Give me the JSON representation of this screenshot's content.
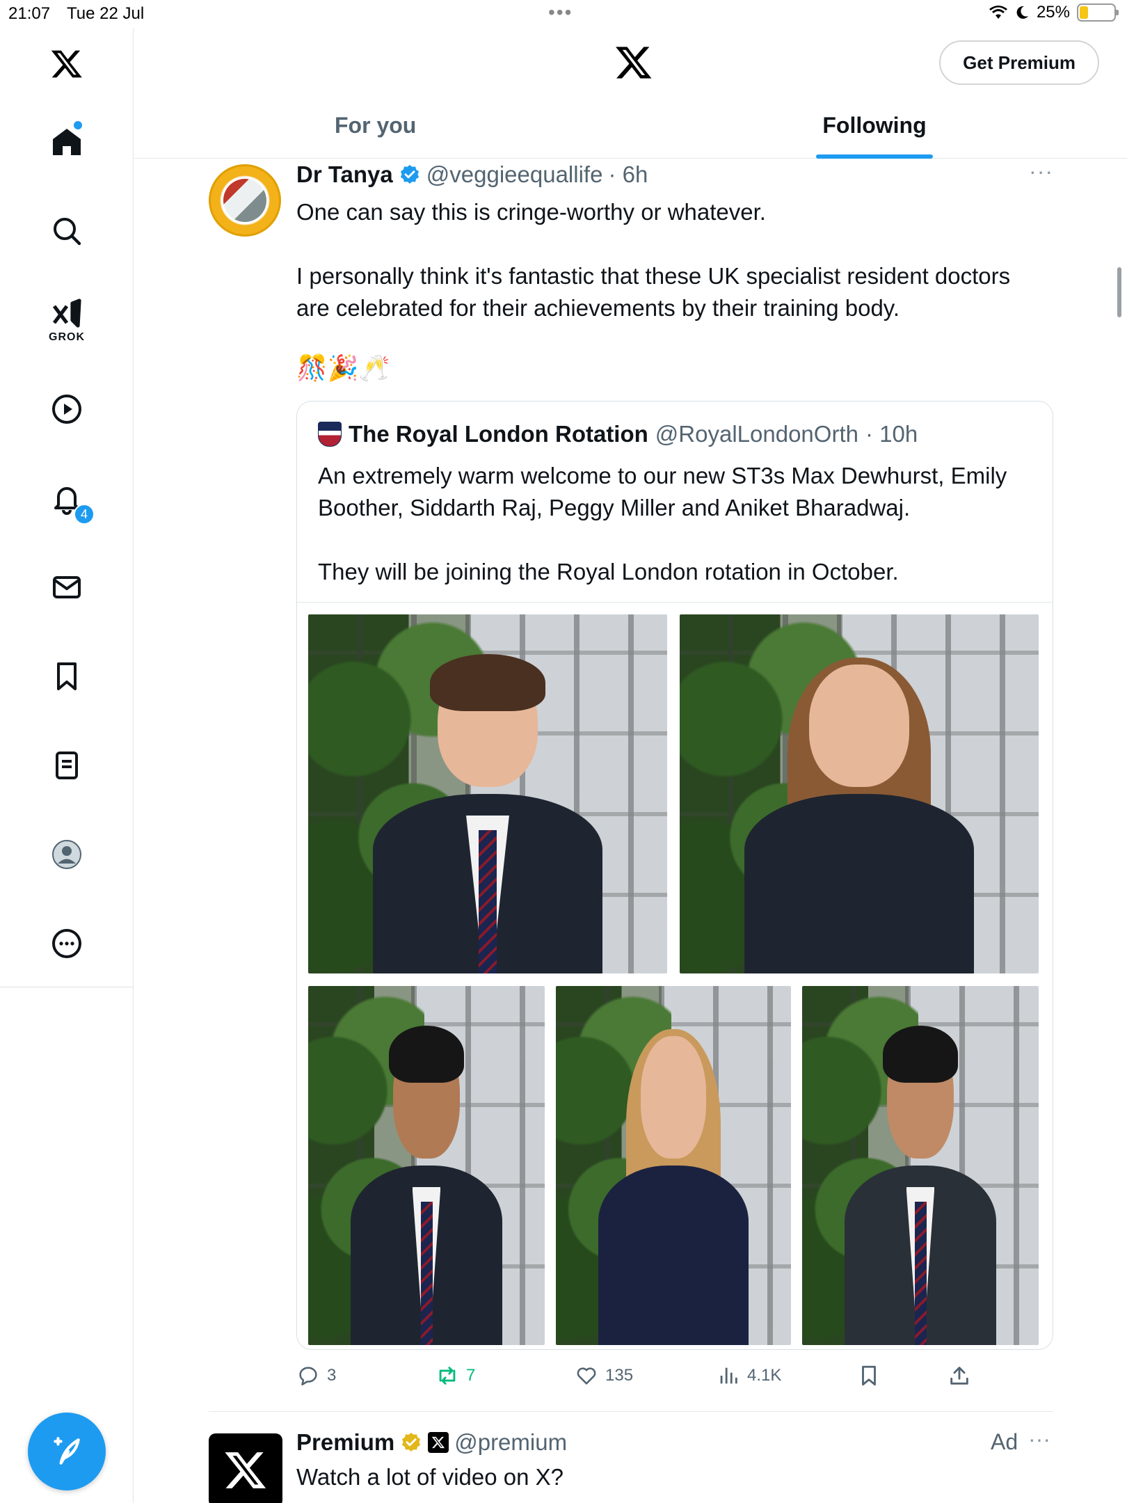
{
  "status_bar": {
    "time": "21:07",
    "date": "Tue 22 Jul",
    "more": "•••",
    "battery": "25%",
    "battery_level": 0.25
  },
  "sidebar": {
    "items": [
      {
        "name": "home",
        "icon": "home-icon"
      },
      {
        "name": "explore",
        "icon": "search-icon"
      },
      {
        "name": "grok",
        "icon": "grok-icon",
        "label": "GROK"
      },
      {
        "name": "videos",
        "icon": "play-icon"
      },
      {
        "name": "notifications",
        "icon": "bell-icon",
        "badge": "4"
      },
      {
        "name": "messages",
        "icon": "mail-icon"
      },
      {
        "name": "bookmarks",
        "icon": "bookmark-icon"
      },
      {
        "name": "lists",
        "icon": "list-icon"
      },
      {
        "name": "profile",
        "icon": "avatar-icon"
      },
      {
        "name": "more",
        "icon": "more-circle-icon"
      }
    ],
    "compose_icon": "compose-icon"
  },
  "header": {
    "premium_button": "Get Premium",
    "tabs": [
      {
        "label": "For you",
        "active": false
      },
      {
        "label": "Following",
        "active": true
      }
    ]
  },
  "tweet": {
    "name": "Dr Tanya",
    "handle": "@veggieequallife",
    "time": "· 6h",
    "text": "One can say this is cringe-worthy or whatever.\n\nI personally think it's fantastic that these UK specialist resident doctors are celebrated for their achievements by their training body.",
    "emojis": "🎊🎉🥂",
    "more": "···",
    "quote": {
      "name": "The Royal London Rotation",
      "handle": "@RoyalLondonOrth",
      "time": "· 10h",
      "text": "An extremely warm welcome to our new ST3s Max Dewhurst, Emily Boother, Siddarth Raj, Peggy Miller and Aniket Bharadwaj.\n\nThey will be joining the Royal London rotation in October."
    },
    "actions": {
      "replies": "3",
      "reposts": "7",
      "likes": "135",
      "views": "4.1K"
    }
  },
  "ad": {
    "name": "Premium",
    "handle": "@premium",
    "label": "Ad",
    "more": "···",
    "text": "Watch a lot of video on X?"
  },
  "colors": {
    "accent": "#1d9bf0",
    "repost": "#00ba7c",
    "muted": "#536471"
  }
}
